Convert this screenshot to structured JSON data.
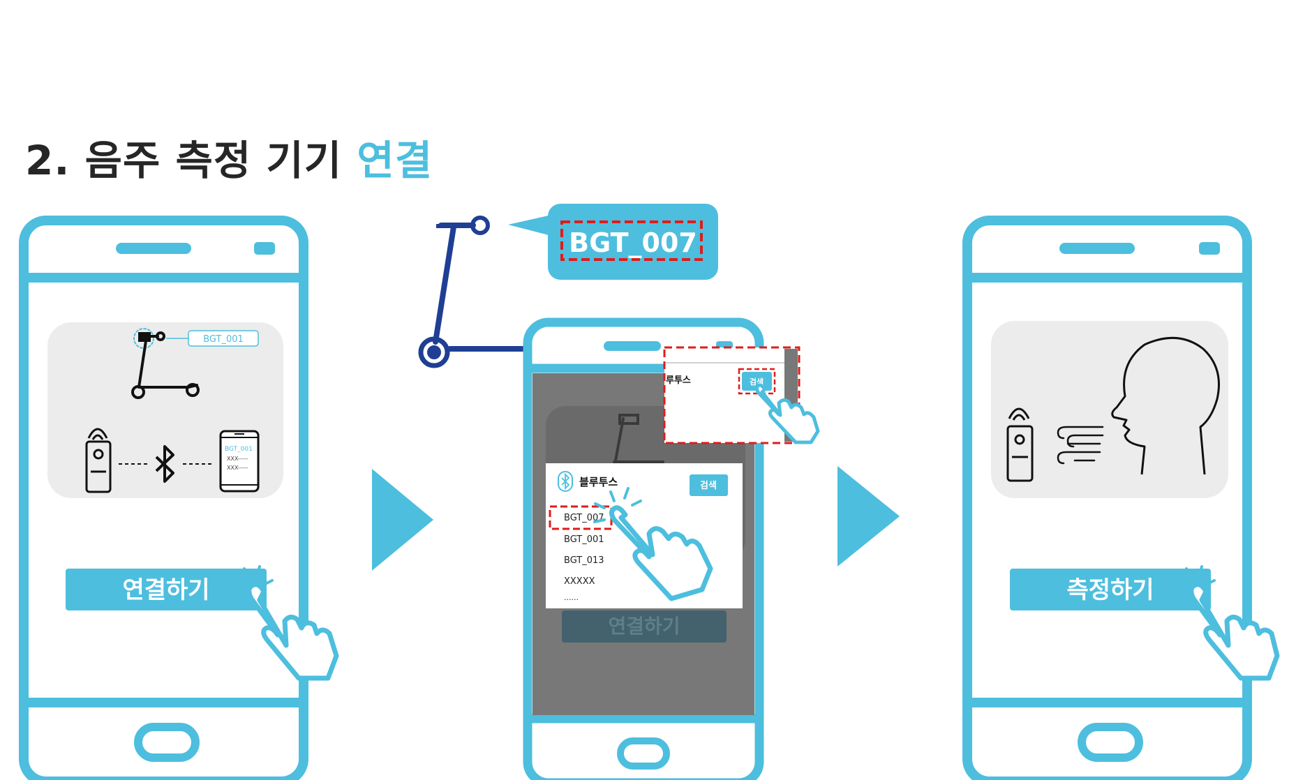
{
  "title": {
    "prefix": "2. 음주 측정 기기",
    "accent": "연결"
  },
  "phone1": {
    "scooter_tag": "BGT_001",
    "device_name": "BGT_001",
    "device_line1": "XXX-----",
    "device_line2": "XXX-----",
    "button_label": "연결하기"
  },
  "callout": {
    "device_id": "BGT_007"
  },
  "phone2": {
    "dialog_title": "블루투스",
    "search_label": "검색",
    "zoom_title": "루투스",
    "zoom_search_label": "검색",
    "devices": [
      "BGT_007",
      "BGT_001",
      "BGT_013",
      "XXXXX",
      "......"
    ],
    "button_label": "연결하기"
  },
  "phone3": {
    "button_label": "측정하기"
  },
  "colors": {
    "accent": "#4dbede",
    "dark_blue": "#1f3f94",
    "highlight": "#e01b1b",
    "overlay": "#787878"
  }
}
